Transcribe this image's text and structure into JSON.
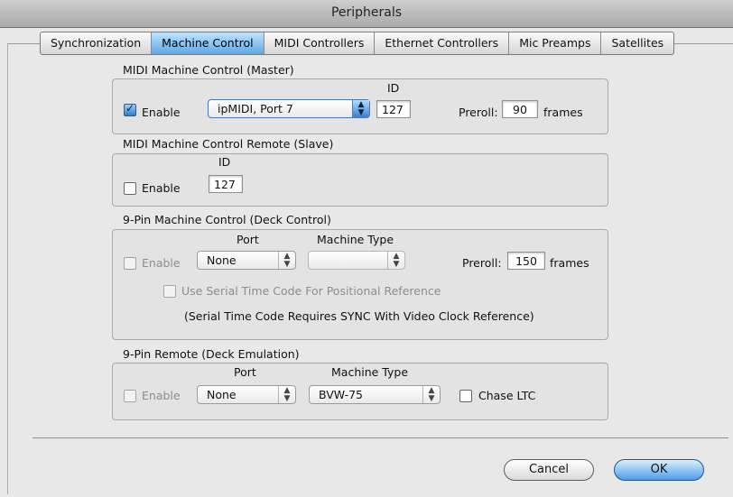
{
  "window": {
    "title": "Peripherals"
  },
  "tabs": [
    {
      "label": "Synchronization",
      "active": false
    },
    {
      "label": "Machine Control",
      "active": true
    },
    {
      "label": "MIDI Controllers",
      "active": false
    },
    {
      "label": "Ethernet Controllers",
      "active": false
    },
    {
      "label": "Mic Preamps",
      "active": false
    },
    {
      "label": "Satellites",
      "active": false
    }
  ],
  "mmc_master": {
    "title": "MIDI Machine Control (Master)",
    "enable_label": "Enable",
    "enabled": true,
    "port_value": "ipMIDI, Port 7",
    "id_label": "ID",
    "id_value": "127",
    "preroll_label": "Preroll:",
    "preroll_value": "90",
    "frames_label": "frames"
  },
  "mmc_remote": {
    "title": "MIDI Machine Control Remote (Slave)",
    "enable_label": "Enable",
    "enabled": false,
    "id_label": "ID",
    "id_value": "127"
  },
  "ninepin": {
    "title": "9-Pin Machine Control (Deck Control)",
    "enable_label": "Enable",
    "enabled": false,
    "port_label": "Port",
    "port_value": "None",
    "machine_type_label": "Machine Type",
    "machine_type_value": "",
    "preroll_label": "Preroll:",
    "preroll_value": "150",
    "frames_label": "frames",
    "serial_tc_label": "Use Serial Time Code For Positional Reference",
    "serial_note": "(Serial Time Code Requires SYNC With Video Clock Reference)"
  },
  "ninepin_remote": {
    "title": "9-Pin Remote (Deck Emulation)",
    "enable_label": "Enable",
    "enabled": false,
    "port_label": "Port",
    "port_value": "None",
    "machine_type_label": "Machine Type",
    "machine_type_value": "BVW-75",
    "chase_label": "Chase LTC"
  },
  "buttons": {
    "cancel": "Cancel",
    "ok": "OK"
  },
  "icons": {
    "popup_arrows": "up-down-arrows-icon",
    "check": "checkmark-icon"
  },
  "colors": {
    "accent": "#5ea8e6",
    "window_bg": "#e8e8e8"
  }
}
